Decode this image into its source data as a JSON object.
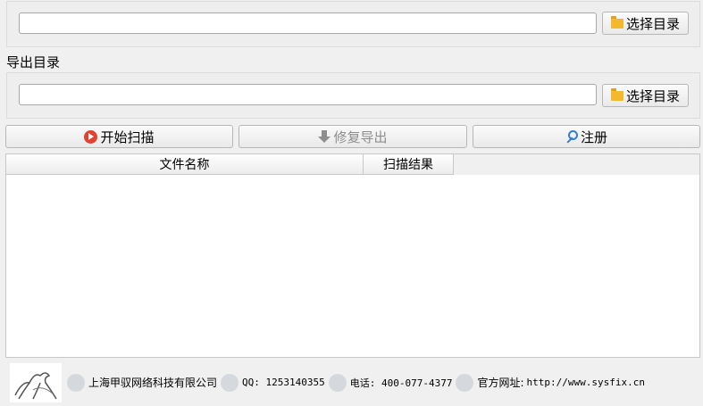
{
  "source_dir": {
    "value": "",
    "button_label": "选择目录"
  },
  "export_dir": {
    "label": "导出目录",
    "value": "",
    "button_label": "选择目录"
  },
  "actions": {
    "start_scan": "开始扫描",
    "repair_export": "修复导出",
    "register": "注册"
  },
  "table": {
    "columns": [
      "文件名称",
      "扫描结果"
    ],
    "rows": []
  },
  "footer": {
    "company": "上海甲驭网络科技有限公司",
    "qq": "QQ: 1253140355",
    "phone": "电话: 400-077-4377",
    "website_label": "官方网址:",
    "website": "http://www.sysfix.cn"
  },
  "colors": {
    "play_icon": "#e2432e",
    "key_icon": "#2f7ed8",
    "folder_icon": "#f3b82b"
  }
}
